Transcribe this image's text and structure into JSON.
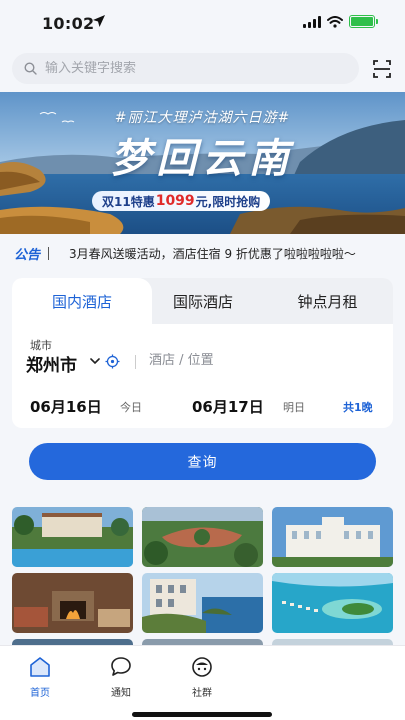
{
  "status_bar": {
    "time": "10:02"
  },
  "search": {
    "placeholder": "输入关键字搜索"
  },
  "banner": {
    "tagline": "#丽江大理泸沽湖六日游#",
    "title": "梦回云南",
    "promo_prefix": "双11特惠",
    "promo_price": "1099",
    "promo_suffix": "元,限时抢购"
  },
  "notice": {
    "tag": "公告",
    "text": "3月春风送暖活动，酒店住宿 9 折优惠了啦啦啦啦啦～"
  },
  "booking": {
    "tabs": [
      "国内酒店",
      "国际酒店",
      "钟点月租"
    ],
    "active_tab": 0,
    "city_label": "城市",
    "city_value": "郑州市",
    "place_placeholder": "酒店 / 位置",
    "checkin_date": "06月16日",
    "checkin_sub": "今日",
    "checkout_date": "06月17日",
    "checkout_sub": "明日",
    "nights": "共1晚"
  },
  "query_button": {
    "label": "查询"
  },
  "gallery": {
    "photos": [
      "resort-pool",
      "tropical-estate",
      "white-palace",
      "fireplace-lounge",
      "coastal-villa",
      "island-atoll"
    ]
  },
  "tabbar": {
    "items": [
      {
        "label": "首页",
        "icon": "home-icon",
        "active": true
      },
      {
        "label": "通知",
        "icon": "chat-bubble-icon",
        "active": false
      },
      {
        "label": "社群",
        "icon": "community-icon",
        "active": false
      }
    ]
  },
  "colors": {
    "accent": "#2468dc",
    "notice_tag": "#1e63d6",
    "price": "#e02a2a"
  }
}
